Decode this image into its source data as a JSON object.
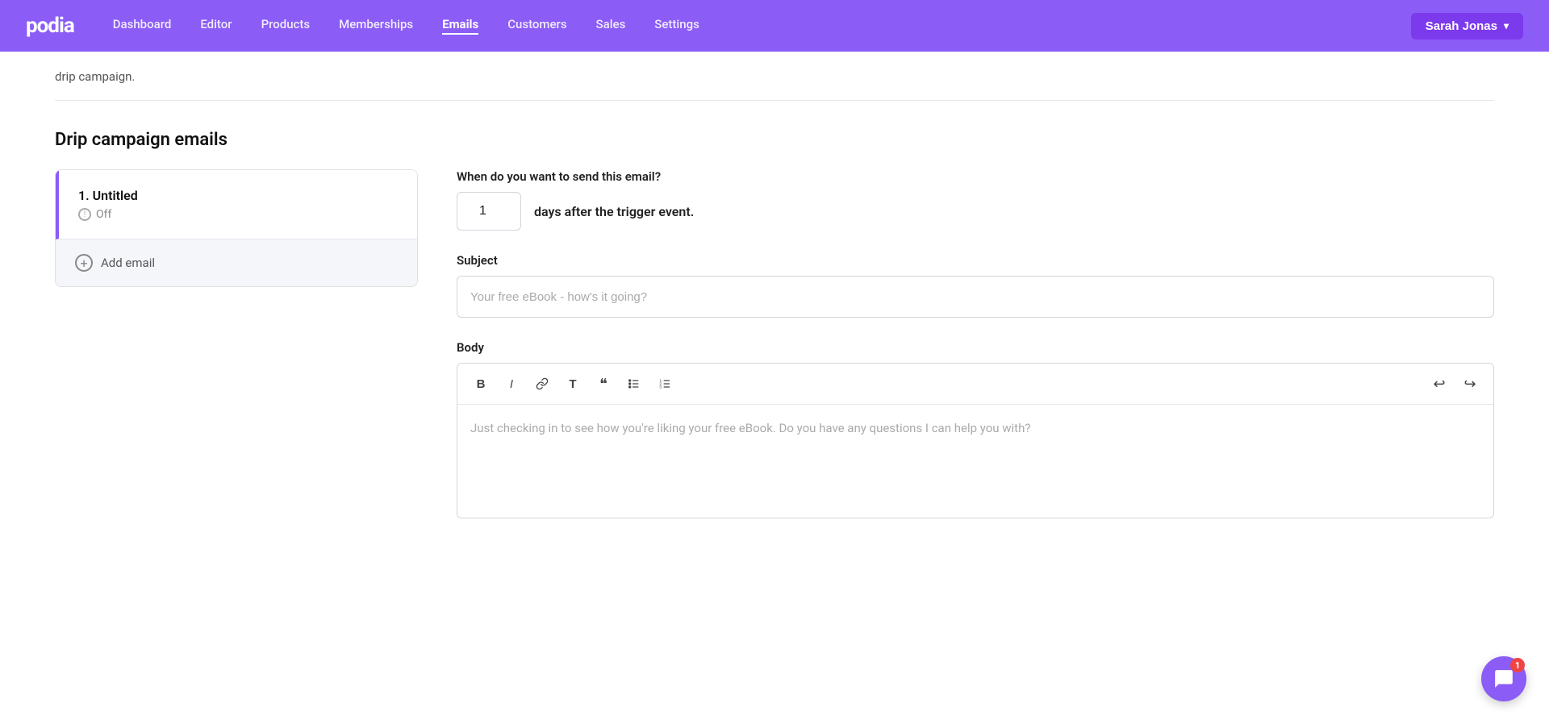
{
  "nav": {
    "logo": "podia",
    "links": [
      {
        "label": "Dashboard",
        "active": false
      },
      {
        "label": "Editor",
        "active": false
      },
      {
        "label": "Products",
        "active": false
      },
      {
        "label": "Memberships",
        "active": false
      },
      {
        "label": "Emails",
        "active": true
      },
      {
        "label": "Customers",
        "active": false
      },
      {
        "label": "Sales",
        "active": false
      },
      {
        "label": "Settings",
        "active": false
      }
    ],
    "user_label": "Sarah Jonas"
  },
  "page": {
    "drip_hint": "drip campaign.",
    "section_title": "Drip campaign emails",
    "email_item": {
      "title": "1. Untitled",
      "status": "Off"
    },
    "add_email_label": "Add email",
    "form": {
      "timing_label": "When do you want to send this email?",
      "timing_value": "1",
      "timing_suffix": "days after the trigger event.",
      "subject_label": "Subject",
      "subject_placeholder": "Your free eBook - how's it going?",
      "body_label": "Body",
      "body_placeholder": "Just checking in to see how you're liking your free eBook. Do you have any questions I can help you with?"
    },
    "toolbar": {
      "bold": "B",
      "italic": "I",
      "link": "🔗",
      "text_style": "T",
      "quote": "❝",
      "bullet_list": "≡",
      "ordered_list": "≣",
      "undo": "↩",
      "redo": "↪"
    },
    "chat_badge": "1"
  }
}
